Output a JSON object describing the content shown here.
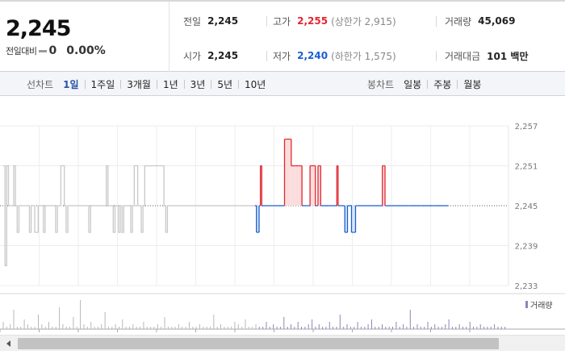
{
  "summary": {
    "current_price": "2,245",
    "change_label": "전일대비",
    "change_value": "0",
    "change_percent": "0.00%"
  },
  "stats": {
    "prev_close": {
      "label": "전일",
      "value": "2,245"
    },
    "high": {
      "label": "고가",
      "value": "2,255",
      "sub": "(상한가 2,915)"
    },
    "volume": {
      "label": "거래량",
      "value": "45,069"
    },
    "open": {
      "label": "시가",
      "value": "2,245"
    },
    "low": {
      "label": "저가",
      "value": "2,240",
      "sub": "(하한가 1,575)"
    },
    "trade_amount": {
      "label": "거래대금",
      "value": "101 백만"
    }
  },
  "toolbar": {
    "line_chart_label": "선차트",
    "periods": [
      "1일",
      "1주일",
      "3개월",
      "1년",
      "3년",
      "5년",
      "10년"
    ],
    "active_period": "1일",
    "candle_chart_label": "봉차트",
    "candle_periods": [
      "일봉",
      "주봉",
      "월봉"
    ]
  },
  "colors": {
    "up": "#e1262f",
    "down": "#1a5fd1",
    "history_line": "#c8c8c8",
    "up_fill": "#fbdcdc",
    "down_fill": "#d8e4f6"
  },
  "chart_data": {
    "type": "line",
    "reference_price": 2245,
    "ylim": [
      2233,
      2257
    ],
    "y_ticks": [
      "2,257",
      "2,251",
      "2,245",
      "2,239",
      "2,233"
    ],
    "y_tick_values": [
      2257,
      2251,
      2245,
      2239,
      2233
    ],
    "grid": true,
    "series": [
      {
        "x": [
          0,
          1,
          2,
          3,
          4,
          5,
          6,
          7,
          8,
          9,
          10,
          11,
          12,
          13,
          14,
          15,
          16,
          17,
          18,
          19,
          20,
          21,
          22,
          23,
          24,
          25,
          26,
          27,
          28,
          29,
          30,
          31,
          32,
          33,
          34,
          35,
          36,
          37,
          38,
          39,
          40,
          41,
          42,
          43,
          44,
          45,
          46,
          47,
          48,
          49,
          50,
          51,
          52,
          53,
          54,
          55,
          56,
          57,
          58,
          59,
          60,
          61,
          62,
          63,
          64,
          65,
          66,
          67,
          68,
          69,
          70,
          71,
          72,
          73,
          74,
          75,
          76,
          77,
          78,
          79,
          80,
          81,
          82,
          83,
          84,
          85,
          86,
          87,
          88,
          89,
          90,
          91,
          92,
          93,
          94,
          95,
          96,
          97,
          98,
          99,
          100,
          101,
          102,
          103,
          104,
          105,
          106,
          107,
          108,
          109,
          110,
          111,
          112,
          113,
          114,
          115,
          116,
          117,
          118,
          119,
          120,
          121,
          122,
          123,
          124,
          125,
          126,
          127,
          128,
          129,
          130,
          131,
          132,
          133,
          134,
          135,
          136,
          137,
          138,
          139,
          140,
          141,
          142,
          143
        ],
        "values": [
          2251,
          2236,
          2251,
          2245,
          2245,
          2245,
          2251,
          2245,
          2241,
          2245,
          2245,
          2245,
          2245,
          2245,
          2245,
          2241,
          2245,
          2245,
          2241,
          2241,
          2245,
          2245,
          2245,
          2241,
          2245,
          2245,
          2245,
          2245,
          2245,
          2245,
          2241,
          2245,
          2245,
          2251,
          2251,
          2245,
          2241,
          2245,
          2245,
          2245,
          2245,
          2245,
          2245,
          2245,
          2245,
          2245,
          2245,
          2245,
          2245,
          2241,
          2245,
          2245,
          2245,
          2245,
          2245,
          2245,
          2245,
          2245,
          2245,
          2251,
          2245,
          2245,
          2245,
          2241,
          2245,
          2245,
          2241,
          2245,
          2241,
          2245,
          2245,
          2245,
          2245,
          2241,
          2245,
          2251,
          2251,
          2245,
          2245,
          2241,
          2245,
          2251,
          2251,
          2251,
          2251,
          2251,
          2251,
          2251,
          2251,
          2251,
          2251,
          2251,
          2245,
          2241,
          2245,
          2245,
          2245,
          2245,
          2245,
          2245,
          2245,
          2245,
          2245,
          2245,
          2245,
          2245,
          2245,
          2245,
          2245,
          2245,
          2245,
          2245,
          2245,
          2245,
          2245,
          2245,
          2245,
          2245,
          2245,
          2245,
          2245,
          2245,
          2245,
          2245,
          2245,
          2245,
          2245,
          2245,
          2245,
          2245,
          2245,
          2245,
          2245,
          2245,
          2245,
          2245,
          2245,
          2245,
          2245,
          2245,
          2245,
          2245,
          2245,
          2245
        ]
      },
      {
        "x": [
          0,
          1,
          2,
          3,
          4,
          5,
          6,
          7,
          8,
          9,
          10,
          11,
          12,
          13,
          14,
          15,
          16,
          17,
          18,
          19,
          20,
          21,
          22,
          23,
          24,
          25,
          26,
          27,
          28,
          29,
          30,
          31,
          32,
          33,
          34,
          35,
          36,
          37,
          38,
          39,
          40,
          41,
          42,
          43,
          44,
          45,
          46,
          47,
          48,
          49,
          50,
          51,
          52,
          53,
          54,
          55,
          56,
          57,
          58,
          59,
          60,
          61,
          62,
          63,
          64,
          65,
          66,
          67,
          68,
          69,
          70,
          71,
          72,
          73,
          74,
          75,
          76,
          77,
          78,
          79,
          80,
          81,
          82,
          83,
          84,
          85,
          86,
          87,
          88,
          89,
          90,
          91,
          92,
          93,
          94,
          95,
          96,
          97,
          98,
          99,
          100,
          101,
          102,
          103,
          104,
          105,
          106,
          107,
          108,
          109,
          110,
          111,
          112,
          113,
          114,
          115,
          116,
          117,
          118,
          119,
          120,
          121,
          122,
          123,
          124,
          125,
          126,
          127,
          128,
          129,
          130,
          131,
          132,
          133,
          134,
          135,
          136,
          137,
          138,
          139,
          140,
          141,
          142,
          143
        ],
        "values": [
          2245,
          2241,
          2241,
          2245,
          2251,
          2245,
          2245,
          2245,
          2245,
          2245,
          2245,
          2245,
          2245,
          2245,
          2245,
          2245,
          2245,
          2245,
          2245,
          2245,
          2245,
          2245,
          2255,
          2255,
          2255,
          2255,
          2255,
          2251,
          2251,
          2251,
          2251,
          2251,
          2251,
          2251,
          2251,
          2245,
          2245,
          2245,
          2245,
          2245,
          2245,
          2251,
          2251,
          2251,
          2251,
          2245,
          2245,
          2251,
          2251,
          2245,
          2245,
          2245,
          2245,
          2245,
          2245,
          2245,
          2245,
          2245,
          2245,
          2245,
          2245,
          2251,
          2245,
          2245,
          2245,
          2245,
          2245,
          2241,
          2241,
          2245,
          2245,
          2245,
          2241,
          2241,
          2241,
          2245,
          2245,
          2245,
          2245,
          2245,
          2245,
          2245,
          2245,
          2245,
          2245,
          2245,
          2245,
          2245,
          2245,
          2245,
          2245,
          2245,
          2245,
          2245,
          2245,
          2251,
          2251,
          2245,
          2245,
          2245,
          2245,
          2245,
          2245,
          2245,
          2245,
          2245,
          2245,
          2245,
          2245,
          2245,
          2245,
          2245,
          2245,
          2245,
          2245,
          2245,
          2245,
          2245,
          2245,
          2245,
          2245,
          2245,
          2245,
          2245,
          2245,
          2245,
          2245,
          2245,
          2245,
          2245,
          2245,
          2245,
          2245,
          2245,
          2245,
          2245,
          2245,
          2245,
          2245,
          2245,
          2245,
          2245,
          2245,
          2245
        ]
      }
    ],
    "volume_legend": "거래량",
    "volume": [
      3,
      1,
      2,
      8,
      1,
      1,
      4,
      2,
      1,
      1,
      6,
      2,
      1,
      3,
      1,
      1,
      9,
      2,
      1,
      1,
      5,
      1,
      12,
      2,
      1,
      3,
      1,
      1,
      2,
      7,
      1,
      1,
      2,
      1,
      4,
      1,
      1,
      2,
      1,
      1,
      3,
      1,
      1,
      1,
      2,
      1,
      5,
      1,
      1,
      1,
      2,
      1,
      1,
      3,
      1,
      1,
      2,
      1,
      1,
      1,
      6,
      1,
      2,
      1,
      1,
      1,
      3,
      2,
      1,
      4,
      1,
      1,
      2,
      1,
      1,
      3,
      1,
      2,
      1,
      1,
      5,
      1,
      2,
      1,
      3,
      1,
      1,
      2,
      4,
      1,
      2,
      1,
      1,
      3,
      1,
      1,
      6,
      1,
      2,
      1,
      1,
      3,
      1,
      1,
      2,
      4,
      1,
      1,
      2,
      1,
      1,
      1,
      3,
      1,
      2,
      1,
      8,
      1,
      2,
      1,
      1,
      3,
      1,
      2,
      1,
      1,
      2,
      4,
      1,
      1,
      2,
      1,
      1,
      3,
      1,
      1,
      2,
      1,
      1,
      1,
      2,
      1,
      1,
      1
    ]
  }
}
